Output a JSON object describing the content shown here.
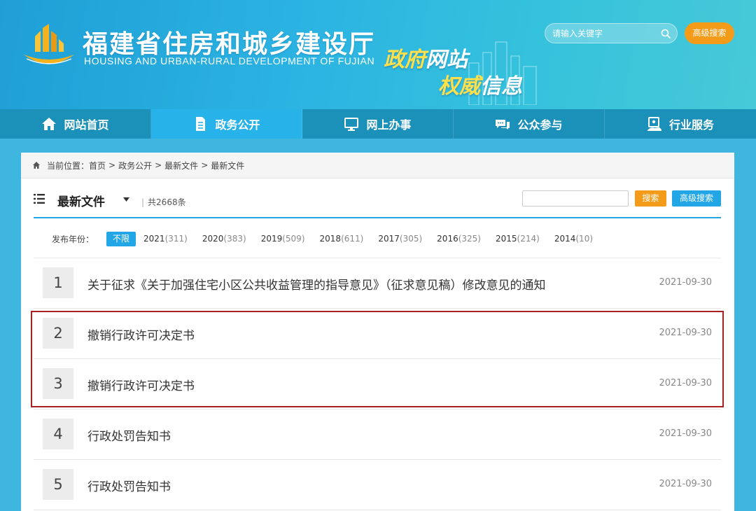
{
  "header": {
    "title": "福建省住房和城乡建设厅",
    "subtitle": "HOUSING AND URBAN-RURAL DEVELOPMENT OF FUJIAN",
    "slogan_1_a": "政府",
    "slogan_1_b": "网站",
    "slogan_2_a": "权威",
    "slogan_2_b": "信息",
    "search_placeholder": "请输入关键字",
    "advanced_search": "高级搜索"
  },
  "nav": {
    "items": [
      {
        "label": "网站首页",
        "icon": "home-icon"
      },
      {
        "label": "政务公开",
        "icon": "document-icon"
      },
      {
        "label": "网上办事",
        "icon": "monitor-icon"
      },
      {
        "label": "公众参与",
        "icon": "chat-icon"
      },
      {
        "label": "行业服务",
        "icon": "service-icon"
      }
    ],
    "active_index": 1
  },
  "breadcrumb": {
    "prefix": "当前位置：",
    "items": [
      "首页",
      "政务公开",
      "最新文件",
      "最新文件"
    ],
    "separator": ">"
  },
  "list": {
    "title": "最新文件",
    "count_text": "共2668条",
    "search_button": "搜索",
    "advanced_search": "高级搜索"
  },
  "years": {
    "label": "发布年份：",
    "active": "不限",
    "items": [
      {
        "year": "2021",
        "count": "(311)"
      },
      {
        "year": "2020",
        "count": "(383)"
      },
      {
        "year": "2019",
        "count": "(509)"
      },
      {
        "year": "2018",
        "count": "(611)"
      },
      {
        "year": "2017",
        "count": "(305)"
      },
      {
        "year": "2016",
        "count": "(325)"
      },
      {
        "year": "2015",
        "count": "(214)"
      },
      {
        "year": "2014",
        "count": "(10)"
      }
    ]
  },
  "documents": [
    {
      "num": "1",
      "title": "关于征求《关于加强住宅小区公共收益管理的指导意见》（征求意见稿）修改意见的通知",
      "date": "2021-09-30"
    },
    {
      "num": "2",
      "title": "撤销行政许可决定书",
      "date": "2021-09-30"
    },
    {
      "num": "3",
      "title": "撤销行政许可决定书",
      "date": "2021-09-30"
    },
    {
      "num": "4",
      "title": "行政处罚告知书",
      "date": "2021-09-30"
    },
    {
      "num": "5",
      "title": "行政处罚告知书",
      "date": "2021-09-30"
    }
  ],
  "colors": {
    "accent": "#23a6e6",
    "orange": "#f49c1a",
    "nav_bg": "#1b90b8",
    "nav_active": "#27b2ea",
    "highlight": "#a82020"
  }
}
